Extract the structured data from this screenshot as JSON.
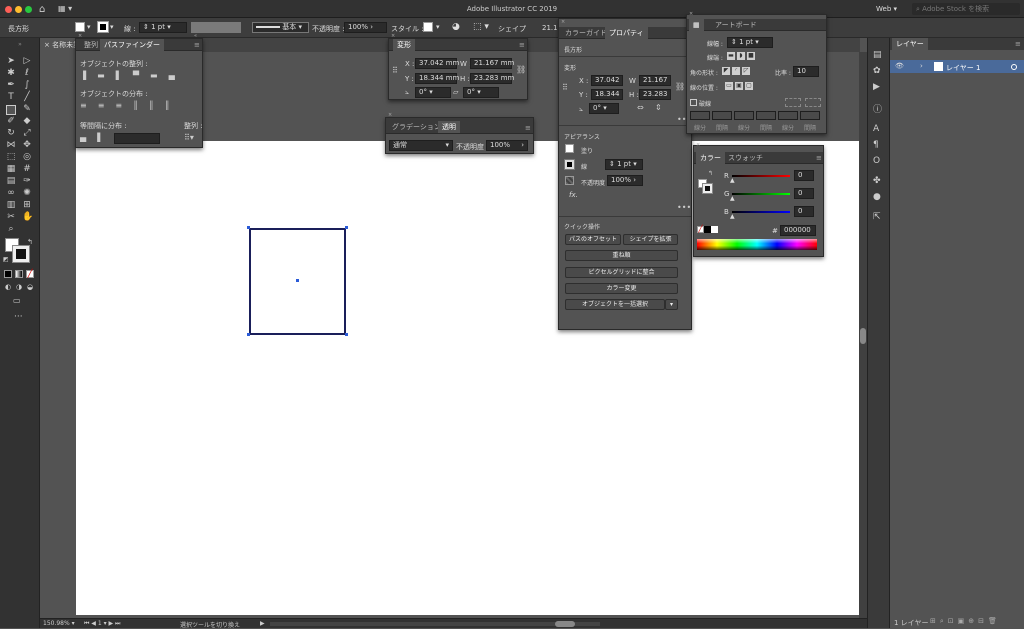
{
  "app": {
    "title": "Adobe Illustrator CC 2019",
    "workspace": "Web",
    "stock_search_placeholder": "Adobe Stock を検索",
    "home_icon": "home-icon"
  },
  "controlbar": {
    "tool_name": "長方形",
    "stroke_label": "線 :",
    "stroke_value": "1 pt",
    "brush_style": "基本",
    "opacity_label": "不透明度 :",
    "opacity_value": "100%",
    "style_label": "スタイル :",
    "shape_label": "シェイプ",
    "shape_value": "21.1"
  },
  "document": {
    "tab_name": "名称未設"
  },
  "align_panel": {
    "tab1": "整列",
    "tab2": "パスファインダー",
    "align_objects": "オブジェクトの整列 :",
    "distribute_objects": "オブジェクトの分布 :",
    "distribute_spacing": "等間隔に分布 :",
    "align_to": "整列 :"
  },
  "transform_panel": {
    "title": "変形",
    "x_label": "X :",
    "x": "37.042 mm",
    "w_label": "W :",
    "w": "21.167 mm",
    "y_label": "Y :",
    "y": "18.344 mm",
    "h_label": "H :",
    "h": "23.283 mm",
    "angle": "0°",
    "shear": "0°"
  },
  "transparency_panel": {
    "tab1": "グラデーション",
    "tab2": "透明",
    "blend": "通常",
    "opacity_label": "不透明度 :",
    "opacity": "100%"
  },
  "properties_panel": {
    "tab1": "カラーガイド",
    "tab2": "プロパティ",
    "object_type": "長方形",
    "transform_heading": "変形",
    "x_label": "X :",
    "x": "37.042",
    "w_label": "W :",
    "w": "21.167",
    "y_label": "Y :",
    "y": "18.344",
    "h_label": "H :",
    "h": "23.283",
    "angle": "0°",
    "appearance_heading": "アピアランス",
    "fill_label": "塗り",
    "stroke_label": "線",
    "stroke_value": "1 pt",
    "opacity_label": "不透明度",
    "opacity_value": "100%",
    "fx_label": "fx.",
    "quick_actions_heading": "クイック操作",
    "btn_offset_path": "パスのオフセット",
    "btn_expand_shape": "シェイプを拡張",
    "btn_arrange": "重ね順",
    "btn_pixel_grid": "ピクセルグリッドに整合",
    "btn_recolor": "カラー変更",
    "btn_select_same": "オブジェクトを一括選択"
  },
  "artboard_panel": {
    "tab1": "アートボード",
    "stroke_width_label": "線幅 :",
    "stroke_width": "1 pt",
    "cap_label": "線端 :",
    "corner_label": "角の形状 :",
    "limit_label": "比率 :",
    "limit_value": "10",
    "align_label": "線の位置 :",
    "dashed_label": "破線",
    "dash_labels": [
      "線分",
      "間隔",
      "線分",
      "間隔",
      "線分",
      "間隔"
    ]
  },
  "color_panel": {
    "tab1": "カラー",
    "tab2": "スウォッチ",
    "r_label": "R",
    "r": "0",
    "g_label": "G",
    "g": "0",
    "b_label": "B",
    "b": "0",
    "hex_label": "#",
    "hex": "000000"
  },
  "layers_panel": {
    "tab": "レイヤー",
    "layer_name": "レイヤー 1",
    "footer_count": "1 レイヤー"
  },
  "statusbar": {
    "zoom": "150.98%",
    "artboard_num": "1",
    "status_text": "選択ツールを切り換え"
  },
  "colors": {
    "accent_blue": "#2b5bd7",
    "rect_stroke": "#1a1f5a",
    "panel_bg": "#535353",
    "chrome_dark": "#323232"
  }
}
